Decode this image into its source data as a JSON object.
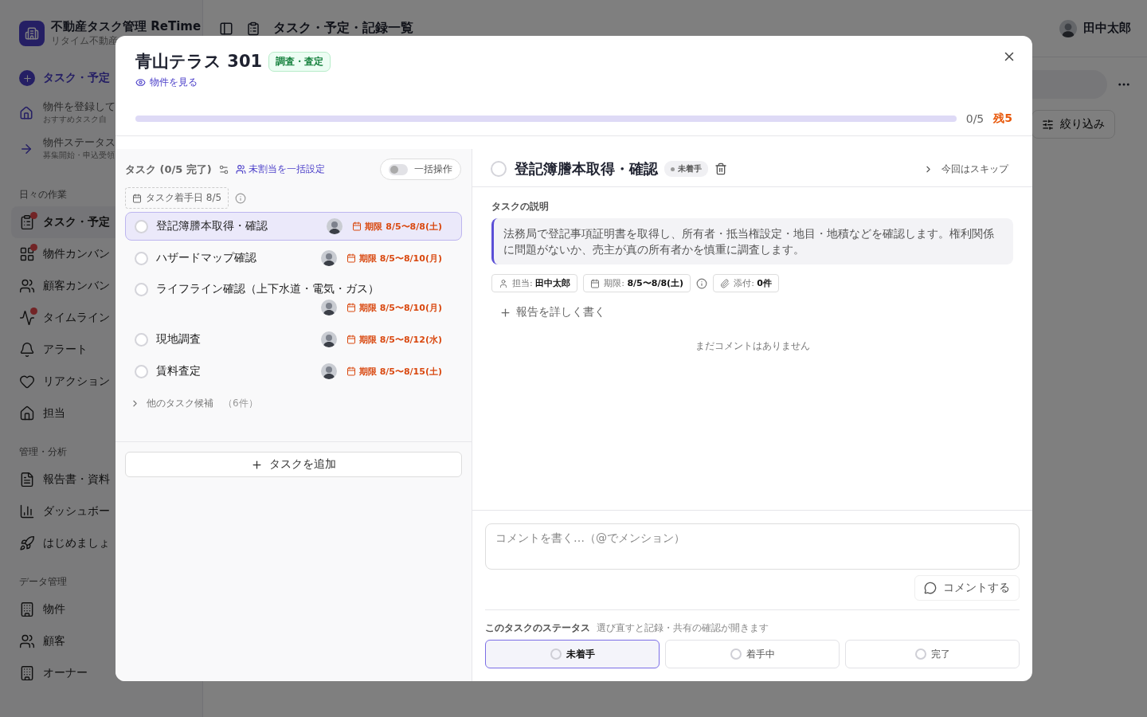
{
  "app": {
    "title": "不動産タスク管理 ReTime",
    "subtitle": "リタイム不動産"
  },
  "sidebar": {
    "primary_action": "タスク・予定",
    "guides": [
      {
        "title": "物件を登録して",
        "subtitle": "おすすめタスク自"
      },
      {
        "title": "物件ステータス",
        "subtitle": "募集開始・申込受領"
      }
    ],
    "sections": [
      {
        "heading": "日々の作業",
        "items": [
          {
            "label": "タスク・予定",
            "selected": true,
            "notification_dot": true
          },
          {
            "label": "物件カンバン",
            "selected": false,
            "notification_dot": true
          },
          {
            "label": "顧客カンバン",
            "selected": false,
            "notification_dot": false
          },
          {
            "label": "タイムライン",
            "selected": false,
            "notification_dot": true
          },
          {
            "label": "アラート",
            "selected": false,
            "notification_dot": false
          },
          {
            "label": "リアクション",
            "selected": false,
            "notification_dot": false
          },
          {
            "label": "担当",
            "selected": false,
            "notification_dot": false
          }
        ]
      },
      {
        "heading": "管理・分析",
        "items": [
          {
            "label": "報告書・資料",
            "selected": false,
            "notification_dot": false
          },
          {
            "label": "ダッシュボー",
            "selected": false,
            "notification_dot": false
          },
          {
            "label": "はじめましょ",
            "selected": false,
            "notification_dot": false
          }
        ]
      },
      {
        "heading": "データ管理",
        "items": [
          {
            "label": "物件",
            "selected": false,
            "notification_dot": false
          },
          {
            "label": "顧客",
            "selected": false,
            "notification_dot": false
          },
          {
            "label": "オーナー",
            "selected": false,
            "notification_dot": false
          }
        ]
      }
    ]
  },
  "header": {
    "page_title": "タスク・予定・記録一覧",
    "user": "田中太郎",
    "filter_button": "絞り込み"
  },
  "modal": {
    "title": "青山テラス 301",
    "tag": "調査・査定",
    "view_link": "物件を見る",
    "progress": {
      "level": 0,
      "count": "0/5",
      "remaining": "残5"
    },
    "task_panel": {
      "heading": "タスク (0/5 完了)",
      "bulk_assign": "未割当を一括設定",
      "bulk_toggle": {
        "label": "一括操作",
        "on": false
      },
      "start_date": "タスク着手日 8/5",
      "tasks": [
        {
          "title": "登記簿謄本取得・確認",
          "due": "期限 8/5〜8/8(土)",
          "selected": true,
          "done": false
        },
        {
          "title": "ハザードマップ確認",
          "due": "期限 8/5〜8/10(月)",
          "selected": false,
          "done": false
        },
        {
          "title": "ライフライン確認（上下水道・電気・ガス）",
          "due": "期限 8/5〜8/10(月)",
          "selected": false,
          "done": false
        },
        {
          "title": "現地調査",
          "due": "期限 8/5〜8/12(水)",
          "selected": false,
          "done": false
        },
        {
          "title": "賃料査定",
          "due": "期限 8/5〜8/15(土)",
          "selected": false,
          "done": false
        }
      ],
      "more": {
        "label": "他のタスク候補",
        "count": "（6件）",
        "expanded": false
      },
      "add_button": "タスクを追加"
    },
    "detail": {
      "title": "登記簿謄本取得・確認",
      "done": false,
      "status_badge": "未着手",
      "skip": "今回はスキップ",
      "description_label": "タスクの説明",
      "description": "法務局で登記事項証明書を取得し、所有者・抵当権設定・地目・地積などを確認します。権利関係に問題がないか、売主が真の所有者かを慎重に調査します。",
      "meta": [
        {
          "kind": "assignee",
          "text": "担当: **田中太郎**"
        },
        {
          "kind": "due",
          "text": "期限: **8/5〜8/8(土)**"
        },
        {
          "kind": "attachments",
          "text": "添付: **0件**"
        }
      ],
      "report_link": "報告を詳しく書く",
      "empty_comments": "まだコメントはありません",
      "comment_placeholder": "コメントを書く…（@でメンション）",
      "comment_button": "コメントする",
      "status_label": "このタスクのステータス",
      "status_hint": "選び直すと記録・共有の確認が開きます",
      "statuses": [
        {
          "label": "未着手",
          "selected": true
        },
        {
          "label": "着手中",
          "selected": false
        },
        {
          "label": "完了",
          "selected": false
        }
      ]
    }
  }
}
